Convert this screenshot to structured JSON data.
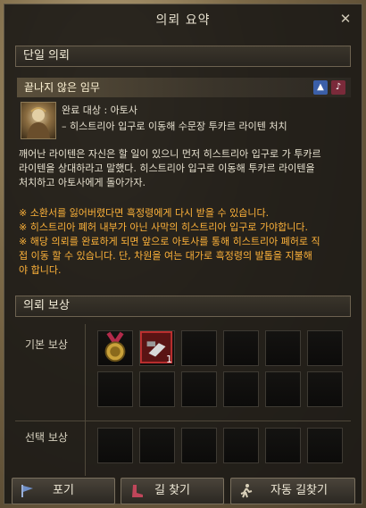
{
  "window": {
    "title": "의뢰 요약",
    "close_icon": "close-icon"
  },
  "section_quest": "단일 의뢰",
  "quest": {
    "title": "끝나지 않은 임무",
    "target_label": "완료 대상 : 아토사",
    "objective": "– 히스트리아 입구로 이동해 수문장 투카르 라이텐 처치",
    "description": [
      "깨어난 라이텐은 자신은 할 일이 있으니 먼저 히스트리아 입구로 가 투카르",
      "라이텐을 상대하라고 말했다. 히스트리아 입구로 이동해 투카르 라이텐을",
      "처치하고 아토사에게 돌아가자."
    ],
    "notices": [
      "※ 소환서를 잃어버렸다면 흑정령에게 다시 받을 수 있습니다.",
      "※ 히스트리아 폐허 내부가 아닌 사막의 히스트리아 입구로 가야합니다.",
      "※ 해당 의뢰를 완료하게 되면 앞으로 아토사를 통해 히스트리아 폐허로 직",
      "접 이동 할 수 있습니다. 단, 차원을 여는 대가로 흑정령의 발톱을 지불해",
      "야 합니다."
    ]
  },
  "section_reward": "의뢰 보상",
  "rewards": {
    "basic_label": "기본 보상",
    "choice_label": "선택 보상",
    "item2_count": "1"
  },
  "buttons": {
    "abandon": "포기",
    "find_path": "길 찾기",
    "auto_path": "자동 길찾기"
  },
  "colors": {
    "notice": "#ffb33a",
    "panel_bg": "#1c1a16"
  }
}
